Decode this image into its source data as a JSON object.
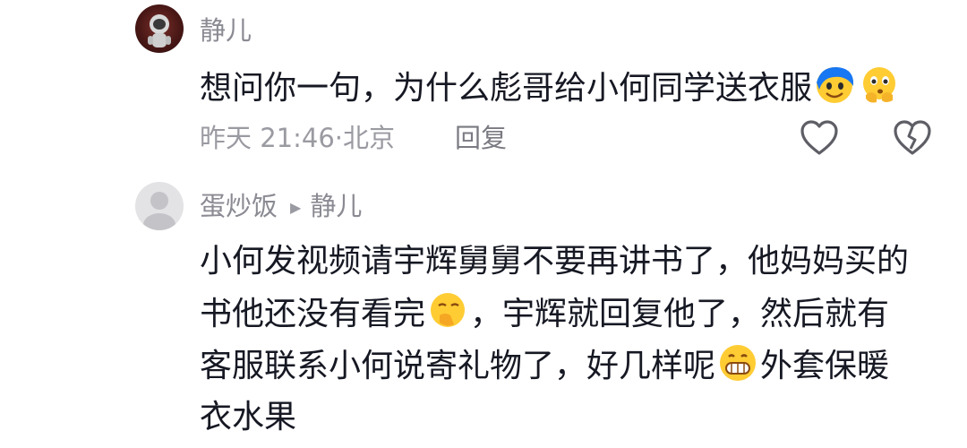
{
  "comment1": {
    "username": "静儿",
    "text": "想问你一句，为什么彪哥给小何同学送衣服",
    "time": "昨天 21:46·北京",
    "reply_label": "回复",
    "icons": [
      "smiling-face-icon",
      "thinking-face-icon"
    ]
  },
  "comment2": {
    "username": "蛋炒饭",
    "reply_to": "静儿",
    "lines": [
      "小何发视频请宇辉舅舅不要再讲书了，他妈妈买的",
      [
        "书他还没有看完",
        "，宇辉就回复他了，然后就有"
      ],
      [
        "客服联系小何说寄礼物了，好几样呢",
        "外套保暖"
      ],
      "衣水果"
    ],
    "icons": [
      "face-with-hand-over-mouth-icon",
      "grinning-face-icon"
    ]
  },
  "colors": {
    "primary_text": "#161823",
    "secondary_text": "#8a8a93"
  }
}
